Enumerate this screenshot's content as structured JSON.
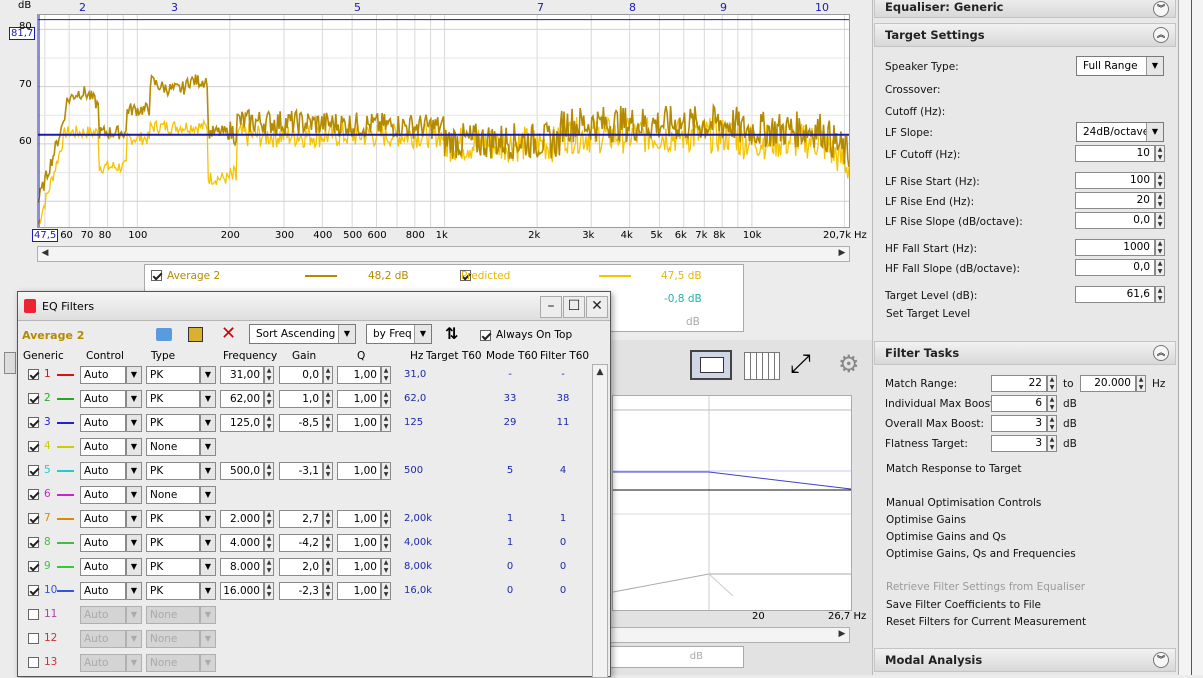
{
  "graph": {
    "unit_label": "dB",
    "hz_label": "Hz",
    "y_cursor_value": "81,7",
    "x_cursor_value": "47,5",
    "x_max_label": "20,7k",
    "y_ticks": [
      "80",
      "70",
      "60"
    ],
    "x_ticks": [
      "60",
      "70",
      "80",
      "100",
      "200",
      "300",
      "400",
      "500",
      "600",
      "800",
      "1k",
      "2k",
      "3k",
      "4k",
      "5k",
      "6k",
      "7k",
      "8k",
      "10k"
    ],
    "top_ticks": [
      "2",
      "3",
      "5",
      "7",
      "8",
      "9",
      "10"
    ],
    "colors": {
      "average": "#b48a00",
      "predicted": "#f5c400",
      "target_line": "#1a1ab0"
    }
  },
  "legend": {
    "row1": {
      "name": "Average 2",
      "value": "48,2 dB",
      "name2": "Predicted",
      "value2": "47,5 dB"
    },
    "row2": {
      "value2": "-0,8 dB"
    },
    "row3": {
      "value2": "dB"
    }
  },
  "graph2": {
    "x_label_1": "20",
    "x_label_2": "26,7 Hz",
    "bottom_field": "dB"
  },
  "right_panel": {
    "equaliser_header": "Equaliser: Generic",
    "target_settings": {
      "title": "Target Settings",
      "speaker_type_label": "Speaker Type:",
      "speaker_type_value": "Full Range",
      "crossover_label": "Crossover:",
      "cutoff_label": "Cutoff (Hz):",
      "lf_slope_label": "LF Slope:",
      "lf_slope_value": "24dB/octave",
      "lf_cutoff_label": "LF Cutoff (Hz):",
      "lf_cutoff_value": "10",
      "lf_rise_start_label": "LF Rise Start (Hz):",
      "lf_rise_start_value": "100",
      "lf_rise_end_label": "LF Rise End (Hz):",
      "lf_rise_end_value": "20",
      "lf_rise_slope_label": "LF Rise Slope (dB/octave):",
      "lf_rise_slope_value": "0,0",
      "hf_fall_start_label": "HF Fall Start (Hz):",
      "hf_fall_start_value": "1000",
      "hf_fall_slope_label": "HF Fall Slope (dB/octave):",
      "hf_fall_slope_value": "0,0",
      "target_level_label": "Target Level (dB):",
      "target_level_value": "61,6",
      "set_target_level": "Set Target Level"
    },
    "filter_tasks": {
      "title": "Filter Tasks",
      "match_range_label": "Match Range:",
      "match_range_from": "22",
      "to_label": "to",
      "match_range_to": "20.000",
      "hz_unit": "Hz",
      "individual_max_boost_label": "Individual Max Boost:",
      "individual_max_boost_value": "6",
      "overall_max_boost_label": "Overall Max Boost:",
      "overall_max_boost_value": "3",
      "flatness_target_label": "Flatness Target:",
      "flatness_target_value": "3",
      "db_unit": "dB",
      "match_response": "Match Response to Target",
      "manual_controls": "Manual Optimisation Controls",
      "optimise_gains": "Optimise Gains",
      "optimise_gains_qs": "Optimise Gains and Qs",
      "optimise_all": "Optimise Gains, Qs and Frequencies",
      "retrieve": "Retrieve Filter Settings from Equaliser",
      "save_coeffs": "Save Filter Coefficients to File",
      "reset_filters": "Reset Filters for Current Measurement"
    },
    "modal_analysis": {
      "title": "Modal Analysis"
    }
  },
  "eq_window": {
    "title": "EQ Filters",
    "measurement_name": "Average 2",
    "sort_value": "Sort Ascending",
    "sort_by_value": "by Freq",
    "always_on_top": "Always On Top",
    "headers": {
      "generic": "Generic",
      "control": "Control",
      "type": "Type",
      "frequency": "Frequency",
      "gain": "Gain",
      "q": "Q",
      "hz": "Hz",
      "target_t60": "Target T60",
      "mode_t60": "Mode T60",
      "filter_t60": "Filter T60"
    },
    "filters": [
      {
        "num": "1",
        "color": "#d11",
        "checked": true,
        "control": "Auto",
        "type": "PK",
        "freq": "31,00",
        "gain": "0,0",
        "q": "1,00",
        "hz": "31,0",
        "mode": "-",
        "filter": "-"
      },
      {
        "num": "2",
        "color": "#2a2",
        "checked": true,
        "control": "Auto",
        "type": "PK",
        "freq": "62,00",
        "gain": "1,0",
        "q": "1,00",
        "hz": "62,0",
        "mode": "33",
        "filter": "38"
      },
      {
        "num": "3",
        "color": "#22c",
        "checked": true,
        "control": "Auto",
        "type": "PK",
        "freq": "125,0",
        "gain": "-8,5",
        "q": "1,00",
        "hz": "125",
        "mode": "29",
        "filter": "11"
      },
      {
        "num": "4",
        "color": "#cc0",
        "checked": true,
        "control": "Auto",
        "type": "None",
        "freq": "",
        "gain": "",
        "q": "",
        "hz": "",
        "mode": "",
        "filter": ""
      },
      {
        "num": "5",
        "color": "#2cc",
        "checked": true,
        "control": "Auto",
        "type": "PK",
        "freq": "500,0",
        "gain": "-3,1",
        "q": "1,00",
        "hz": "500",
        "mode": "5",
        "filter": "4"
      },
      {
        "num": "6",
        "color": "#c2c",
        "checked": true,
        "control": "Auto",
        "type": "None",
        "freq": "",
        "gain": "",
        "q": "",
        "hz": "",
        "mode": "",
        "filter": ""
      },
      {
        "num": "7",
        "color": "#d80",
        "checked": true,
        "control": "Auto",
        "type": "PK",
        "freq": "2.000",
        "gain": "2,7",
        "q": "1,00",
        "hz": "2,00k",
        "mode": "1",
        "filter": "1"
      },
      {
        "num": "8",
        "color": "#4b4",
        "checked": true,
        "control": "Auto",
        "type": "PK",
        "freq": "4.000",
        "gain": "-4,2",
        "q": "1,00",
        "hz": "4,00k",
        "mode": "1",
        "filter": "0"
      },
      {
        "num": "9",
        "color": "#3c3",
        "checked": true,
        "control": "Auto",
        "type": "PK",
        "freq": "8.000",
        "gain": "2,0",
        "q": "1,00",
        "hz": "8,00k",
        "mode": "0",
        "filter": "0"
      },
      {
        "num": "10",
        "color": "#35d",
        "checked": true,
        "control": "Auto",
        "type": "PK",
        "freq": "16.000",
        "gain": "-2,3",
        "q": "1,00",
        "hz": "16,0k",
        "mode": "0",
        "filter": "0"
      },
      {
        "num": "11",
        "color": "#a4a",
        "checked": false,
        "control": "Auto",
        "type": "None",
        "freq": "",
        "gain": "",
        "q": "",
        "hz": "",
        "mode": "",
        "filter": ""
      },
      {
        "num": "12",
        "color": "#c33",
        "checked": false,
        "control": "Auto",
        "type": "None",
        "freq": "",
        "gain": "",
        "q": "",
        "hz": "",
        "mode": "",
        "filter": ""
      },
      {
        "num": "13",
        "color": "#c33",
        "checked": false,
        "control": "Auto",
        "type": "None",
        "freq": "",
        "gain": "",
        "q": "",
        "hz": "",
        "mode": "",
        "filter": ""
      }
    ]
  }
}
